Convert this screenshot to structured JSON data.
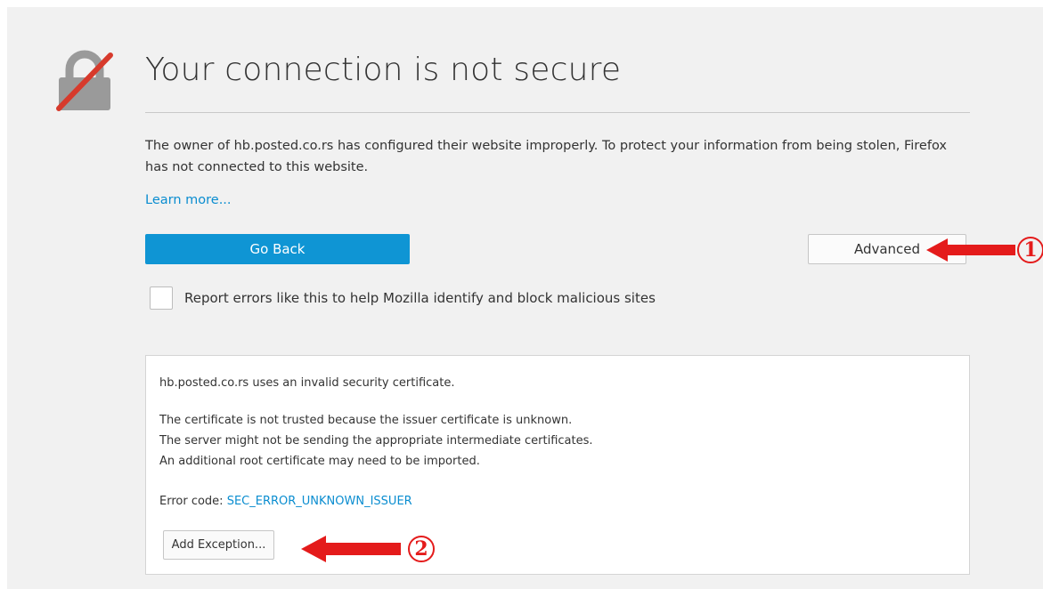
{
  "page": {
    "title": "Your connection is not secure",
    "description": "The owner of hb.posted.co.rs has configured their website improperly. To protect your information from being stolen, Firefox has not connected to this website.",
    "learn_more": "Learn more...",
    "go_back_label": "Go Back",
    "advanced_label": "Advanced",
    "report_label": "Report errors like this to help Mozilla identify and block malicious sites",
    "report_checked": false
  },
  "advanced_panel": {
    "line1": "hb.posted.co.rs uses an invalid security certificate.",
    "line2": "The certificate is not trusted because the issuer certificate is unknown.",
    "line3": "The server might not be sending the appropriate intermediate certificates.",
    "line4": "An additional root certificate may need to be imported.",
    "error_code_label": "Error code:",
    "error_code": "SEC_ERROR_UNKNOWN_ISSUER",
    "add_exception_label": "Add Exception..."
  },
  "annotations": {
    "step1": "1",
    "step2": "2",
    "arrow_color": "#e41b1b"
  },
  "colors": {
    "accent": "#0f95d4",
    "link": "#0a8dd0",
    "lock_gray": "#9a9a9a",
    "lock_slash": "#d73a2c"
  },
  "icons": {
    "lock": "broken-lock-icon"
  }
}
